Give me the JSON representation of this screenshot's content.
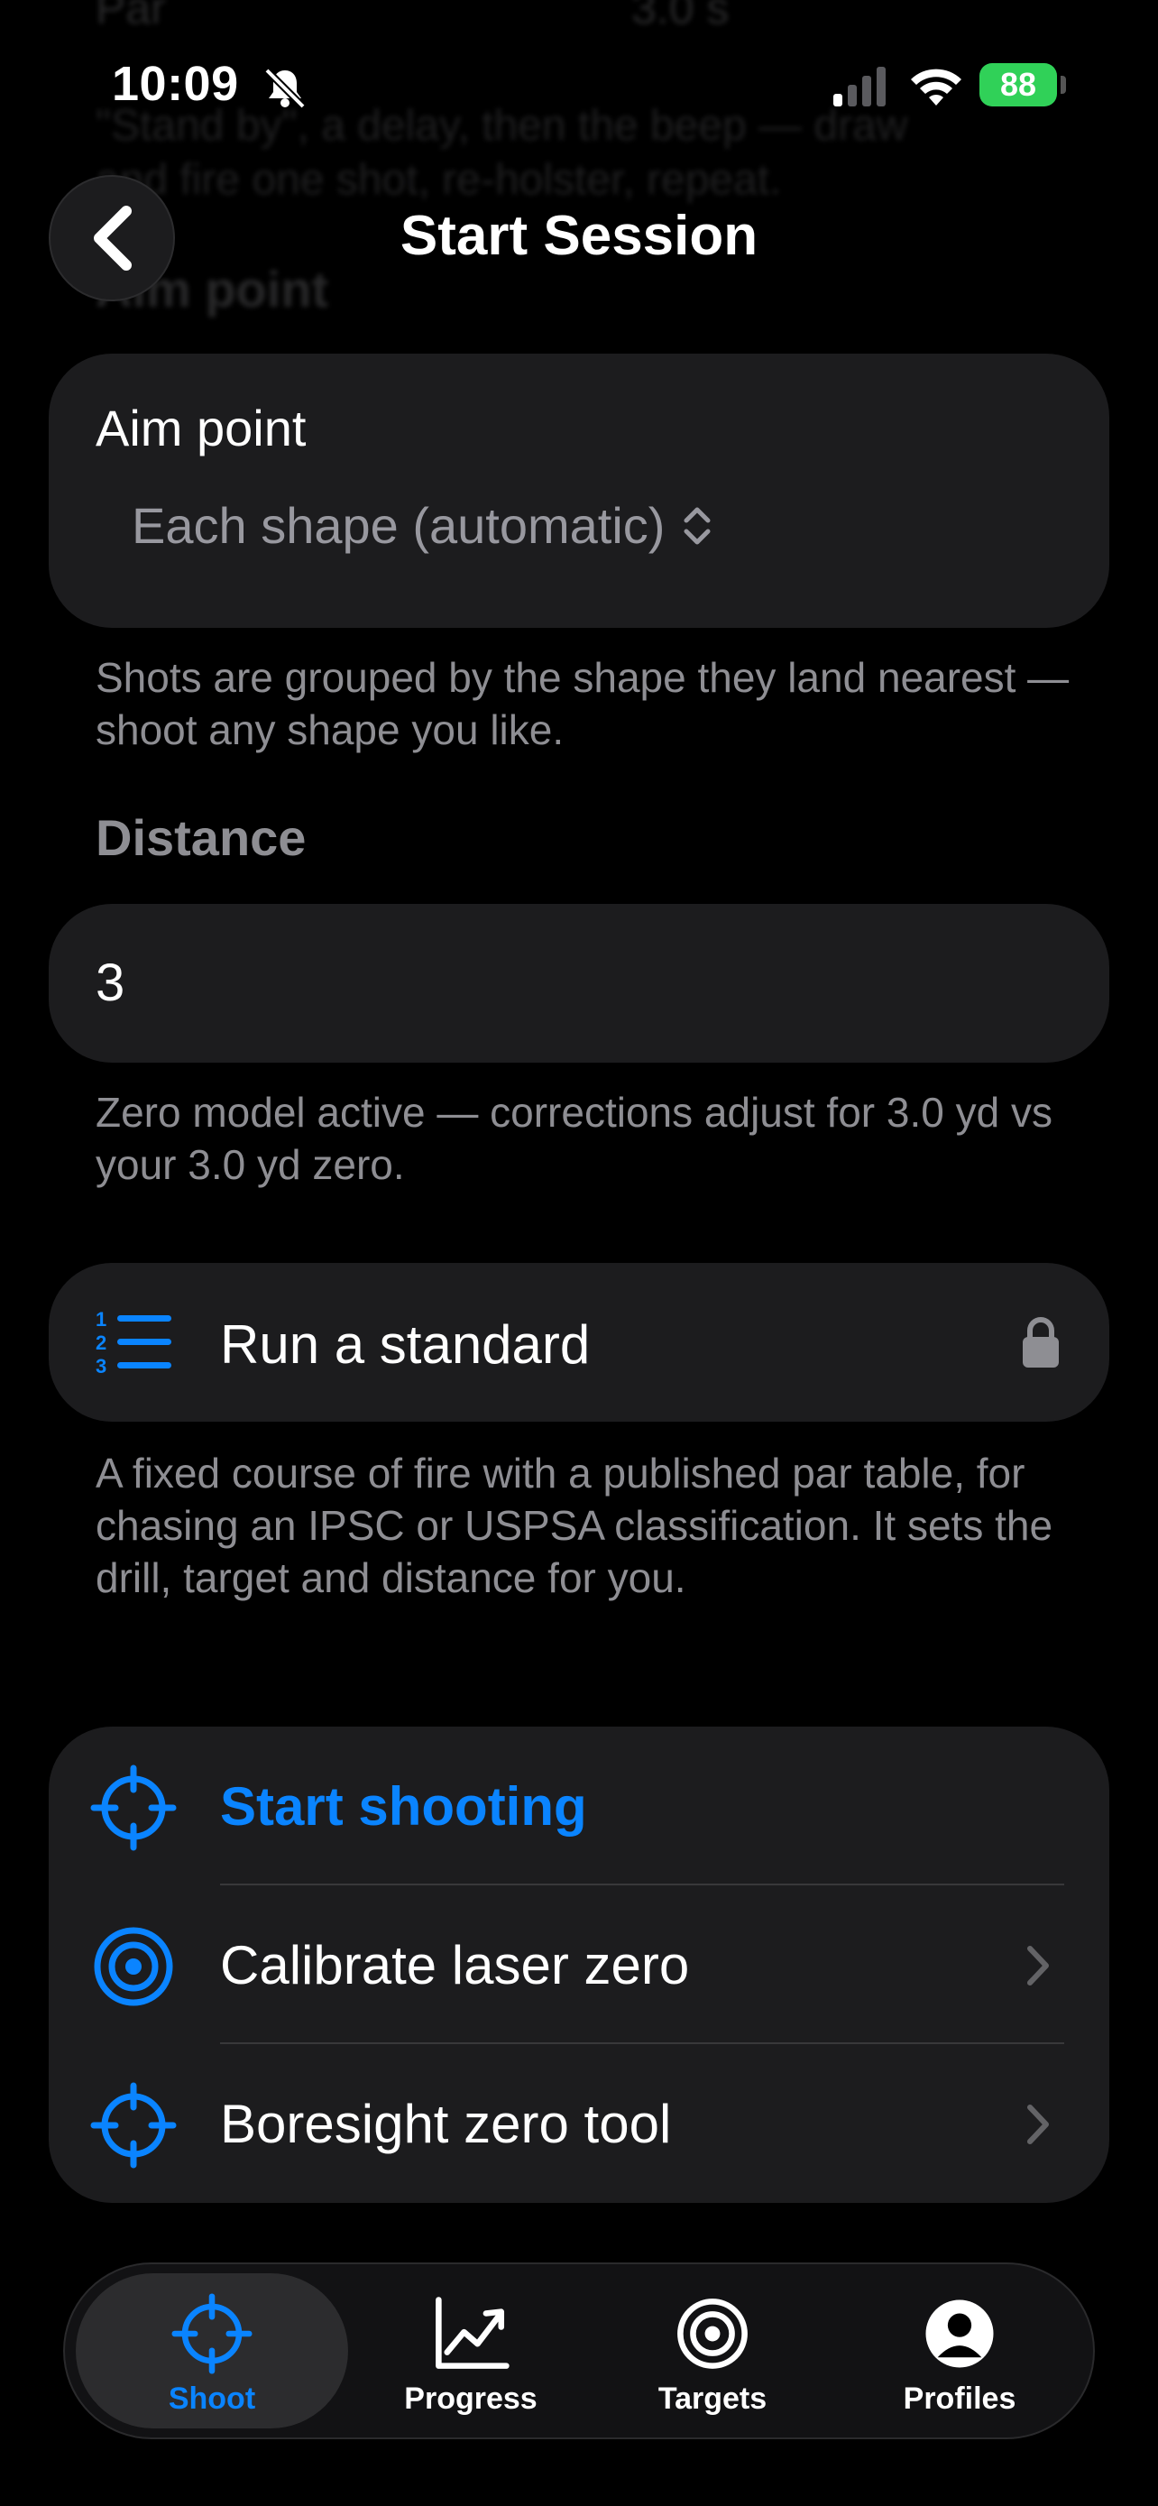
{
  "status_bar": {
    "time": "10:09",
    "battery": "88"
  },
  "nav": {
    "title": "Start Session"
  },
  "aim_point": {
    "label": "Aim point",
    "value": "Each shape (automatic)",
    "footnote": "Shots are grouped by the shape they land nearest — shoot any shape you like."
  },
  "distance": {
    "heading": "Distance",
    "value": "3",
    "footnote": "Zero model active — corrections adjust for 3.0 yd vs your 3.0 yd zero."
  },
  "standard": {
    "label": "Run a standard",
    "footnote": "A fixed course of fire with a published par table, for chasing an IPSC or USPSA classification. It sets the drill, target and distance for you."
  },
  "actions": [
    {
      "label": "Start shooting"
    },
    {
      "label": "Calibrate laser zero"
    },
    {
      "label": "Boresight zero tool"
    }
  ],
  "tabs": [
    {
      "label": "Shoot"
    },
    {
      "label": "Progress"
    },
    {
      "label": "Targets"
    },
    {
      "label": "Profiles"
    }
  ],
  "colors": {
    "accent": "#0a84ff",
    "card": "#1c1c1e",
    "secondary_text": "#8e8e93",
    "battery": "#30d158"
  }
}
